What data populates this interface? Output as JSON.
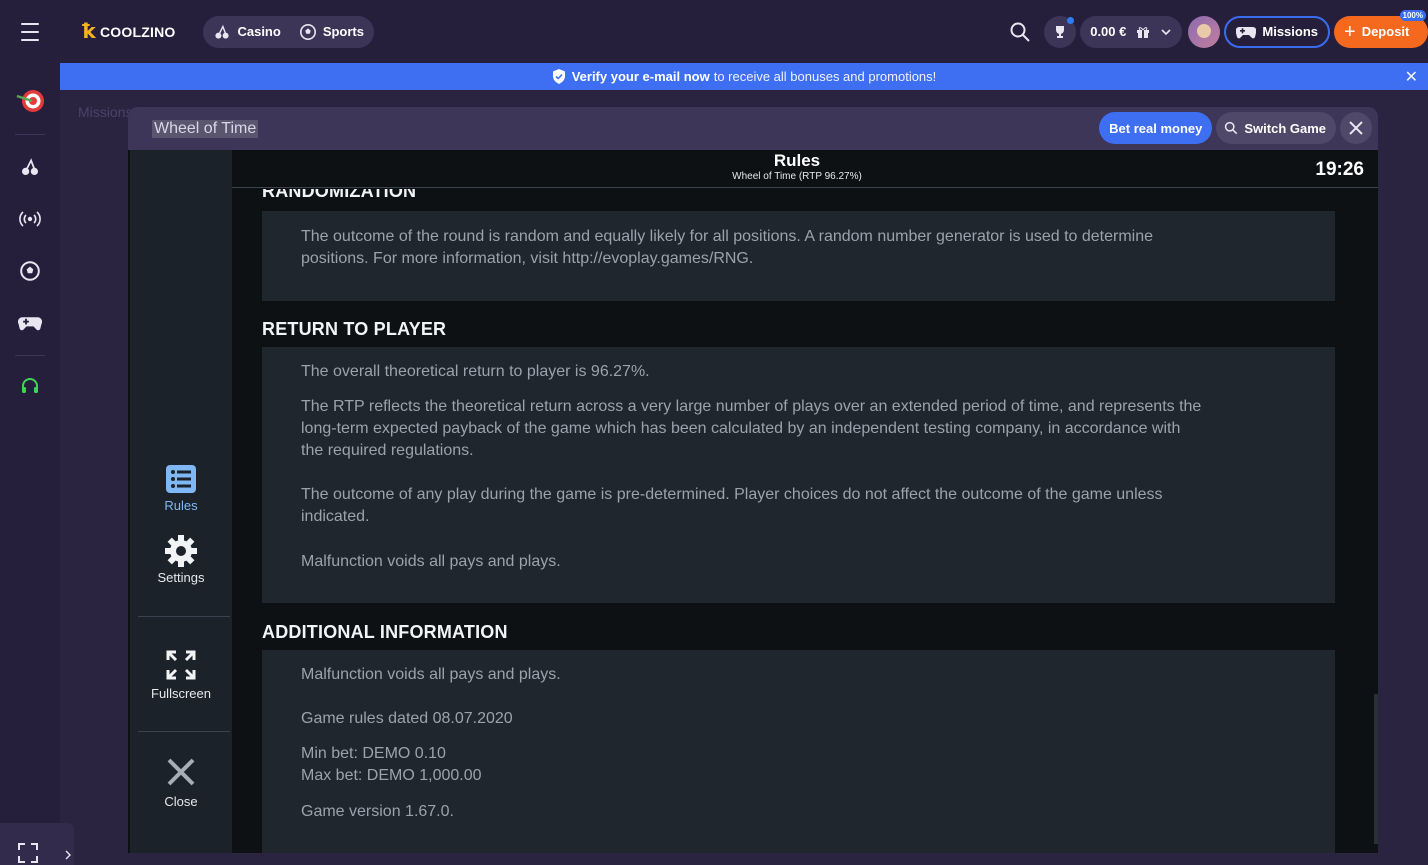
{
  "header": {
    "brand": "COOLZINO",
    "nav": [
      {
        "label": "Casino",
        "icon": "cherry-icon"
      },
      {
        "label": "Sports",
        "icon": "soccer-ball-icon"
      }
    ],
    "balance": "0.00 €",
    "missions_label": "Missions",
    "deposit_label": "Deposit",
    "deposit_badge": "100%"
  },
  "banner": {
    "bold": "Verify your e-mail now",
    "rest": "to receive all bonuses and promotions!"
  },
  "sidebar": {
    "icons": [
      "darts-target-icon",
      "cherry-icon",
      "live-broadcast-icon",
      "soccer-ball-icon",
      "gamepad-icon",
      "headset-icon"
    ]
  },
  "page": {
    "ghost_title": "Missions"
  },
  "modal": {
    "game_title": "Wheel of Time",
    "bet_real_money": "Bet real money",
    "switch_game": "Switch Game"
  },
  "game": {
    "menu": {
      "rules": "Rules",
      "settings": "Settings",
      "fullscreen": "Fullscreen",
      "close": "Close"
    },
    "rules_title": "Rules",
    "rules_subtitle": "Wheel of Time (RTP 96.27%)",
    "clock": "19:26",
    "sections": {
      "randomization": {
        "heading": "RANDOMIZATION",
        "p1": "The outcome of the round is random and equally likely for all positions. A random number generator is used to determine",
        "p1b": "positions. For more information, visit http://evoplay.games/RNG."
      },
      "rtp": {
        "heading": "RETURN TO PLAYER",
        "p1": "The overall theoretical return to player is 96.27%.",
        "p2a": "The RTP reflects the theoretical return across a very large number of plays over an extended period of time, and represents the",
        "p2b": "long-term expected payback of the game which has been calculated by an independent testing company, in accordance with",
        "p2c": "the required regulations.",
        "p3a": "The outcome of any play during the game is pre-determined. Player choices do not affect the outcome of the game unless",
        "p3b": "indicated.",
        "p4": "Malfunction voids all pays and plays."
      },
      "additional": {
        "heading": "ADDITIONAL INFORMATION",
        "p1": "Malfunction voids all pays and plays.",
        "p2": "Game rules dated 08.07.2020",
        "p3": "Min bet: DEMO 0.10",
        "p4": "Max bet: DEMO 1,000.00",
        "p5": "Game version 1.67.0."
      }
    }
  },
  "colors": {
    "bg": "#2a2440",
    "accent_blue": "#3e6ef2",
    "deposit_orange": "#f5691e",
    "rules_active": "#7fb8f4"
  }
}
